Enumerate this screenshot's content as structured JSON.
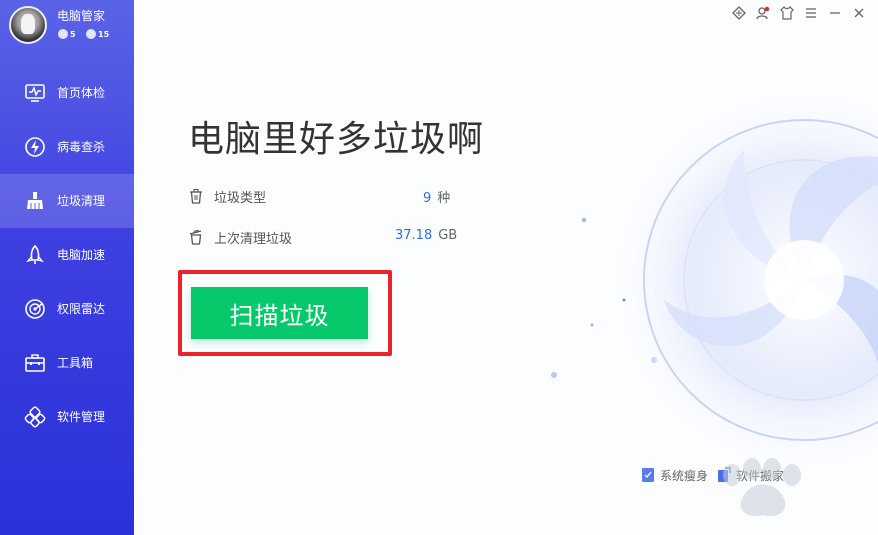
{
  "app": {
    "name": "电脑管家",
    "badges": [
      "5",
      "15"
    ]
  },
  "sidebar": {
    "items": [
      {
        "label": "首页体检",
        "icon": "monitor-icon",
        "active": false
      },
      {
        "label": "病毒查杀",
        "icon": "bolt-shield-icon",
        "active": false
      },
      {
        "label": "垃圾清理",
        "icon": "broom-icon",
        "active": true
      },
      {
        "label": "电脑加速",
        "icon": "rocket-icon",
        "active": false
      },
      {
        "label": "权限雷达",
        "icon": "radar-icon",
        "active": false
      },
      {
        "label": "工具箱",
        "icon": "toolbox-icon",
        "active": false
      },
      {
        "label": "软件管理",
        "icon": "apps-icon",
        "active": false
      }
    ]
  },
  "window_controls": [
    "skin-diamond-icon",
    "user-icon",
    "shirt-icon",
    "menu-icon",
    "minimize-icon",
    "close-icon"
  ],
  "main": {
    "headline": "电脑里好多垃圾啊",
    "stats": [
      {
        "label": "垃圾类型",
        "value": "9",
        "unit": "种",
        "icon": "trash-icon"
      },
      {
        "label": "上次清理垃圾",
        "value": "37.18",
        "unit": "GB",
        "icon": "trash-open-icon"
      }
    ],
    "scan_button": "扫描垃圾"
  },
  "bottom_links": [
    {
      "label": "系统瘦身",
      "icon": "slim-icon"
    },
    {
      "label": "软件搬家",
      "icon": "move-icon"
    }
  ],
  "colors": {
    "sidebar_top": "#5a63e6",
    "sidebar_bottom": "#2a32d8",
    "accent_green": "#07c86b",
    "highlight_red": "#e8252b",
    "value_blue": "#2a6fe0"
  }
}
